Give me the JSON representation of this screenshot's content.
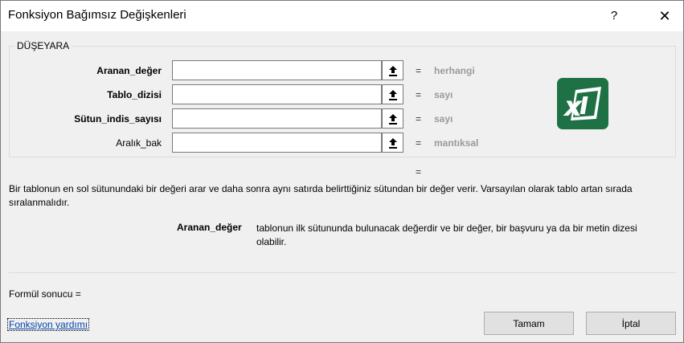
{
  "window": {
    "title": "Fonksiyon Bağımsız Değişkenleri",
    "help_glyph": "?",
    "close_glyph": "✕"
  },
  "function_group": {
    "name": "DÜŞEYARA",
    "arguments": [
      {
        "label": "Aranan_değer",
        "value": "",
        "type_hint": "herhangi",
        "bold": true
      },
      {
        "label": "Tablo_dizisi",
        "value": "",
        "type_hint": "sayı",
        "bold": true
      },
      {
        "label": "Sütun_indis_sayısı",
        "value": "",
        "type_hint": "sayı",
        "bold": true
      },
      {
        "label": "Aralık_bak",
        "value": "",
        "type_hint": "mantıksal",
        "bold": false
      }
    ],
    "equals": "=",
    "collapse_icon": "upload-arrow-icon",
    "logo_icon": "excel-logo-icon",
    "logo_color": "#1e7145"
  },
  "function_result_equals": "=",
  "description": "Bir tablonun en sol sütunundaki bir değeri arar ve daha sonra aynı satırda belirttiğiniz sütundan bir değer verir. Varsayılan olarak tablo artan sırada sıralanmalıdır.",
  "argument_help": {
    "name": "Aranan_değer",
    "text": "tablonun ilk sütununda bulunacak değerdir ve bir değer, bir başvuru ya da bir metin dizesi olabilir."
  },
  "formula_result_label": "Formül sonucu =",
  "help_link": "Fonksiyon yardımı",
  "buttons": {
    "ok": "Tamam",
    "cancel": "İptal"
  }
}
